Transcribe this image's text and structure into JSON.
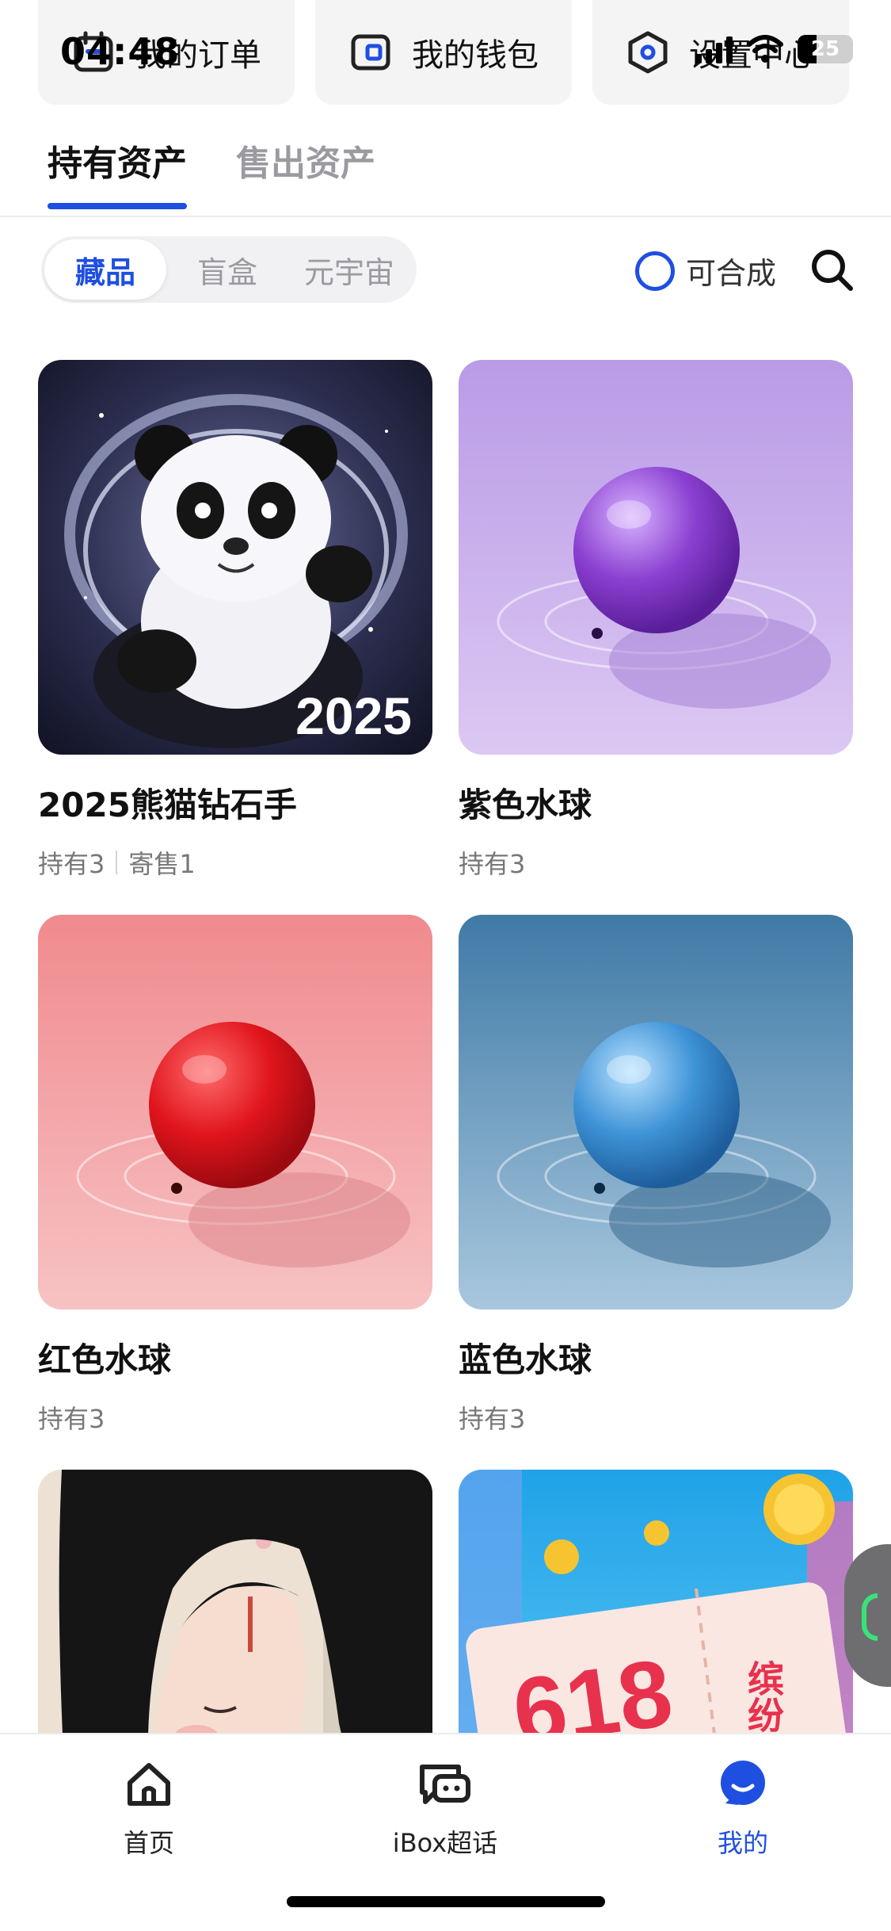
{
  "status_bar": {
    "time": "04:48",
    "battery_level": "25"
  },
  "shortcuts": [
    {
      "label": "我的订单",
      "icon": "calendar-icon"
    },
    {
      "label": "我的钱包",
      "icon": "wallet-icon"
    },
    {
      "label": "设置中心",
      "icon": "settings-hexagon-icon"
    }
  ],
  "asset_tabs": {
    "held": "持有资产",
    "sold": "售出资产",
    "active": "held"
  },
  "filters": {
    "collectibles": "藏品",
    "blind_box": "盲盒",
    "metaverse": "元宇宙",
    "active": "collectibles"
  },
  "mergeable_label": "可合成",
  "items": [
    {
      "name": "2025熊猫钻石手",
      "held": "持有3",
      "consign": "寄售1",
      "image_text": "2025"
    },
    {
      "name": "紫色水球",
      "held": "持有3",
      "consign": ""
    },
    {
      "name": "红色水球",
      "held": "持有3",
      "consign": ""
    },
    {
      "name": "蓝色水球",
      "held": "持有3",
      "consign": ""
    },
    {
      "name": "",
      "held": "",
      "consign": ""
    },
    {
      "name": "",
      "held": "",
      "consign": "",
      "image_text_main": "618",
      "image_text_side": "缤纷券"
    }
  ],
  "bottom_nav": {
    "home": "首页",
    "ibox": "iBox超话",
    "mine": "我的",
    "active": "mine"
  },
  "colors": {
    "accent": "#1f4fe0",
    "background": "#ffffff",
    "muted": "#9a9aa0"
  }
}
